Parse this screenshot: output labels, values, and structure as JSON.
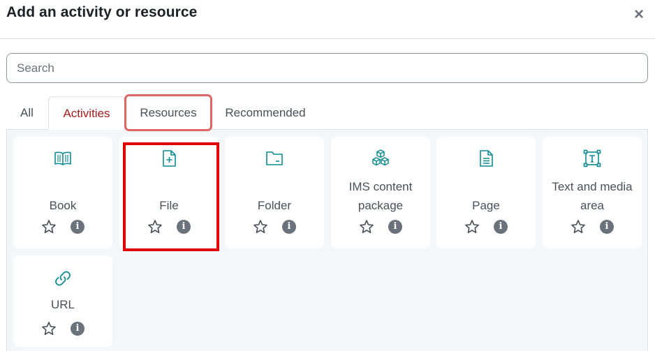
{
  "modal": {
    "title": "Add an activity or resource",
    "close_label": "×"
  },
  "search": {
    "placeholder": "Search",
    "value": ""
  },
  "tabs": [
    {
      "label": "All"
    },
    {
      "label": "Activities",
      "active": true
    },
    {
      "label": "Resources",
      "highlighted": true
    },
    {
      "label": "Recommended"
    }
  ],
  "items": [
    {
      "name": "Book",
      "icon": "book-icon"
    },
    {
      "name": "File",
      "icon": "file-icon",
      "highlighted": true
    },
    {
      "name": "Folder",
      "icon": "folder-icon"
    },
    {
      "name": "IMS content package",
      "line1": "IMS content",
      "line2": "package",
      "icon": "ims-package-icon"
    },
    {
      "name": "Page",
      "icon": "page-icon"
    },
    {
      "name": "Text and media area",
      "line1": "Text and media",
      "line2": "area",
      "icon": "text-media-icon"
    },
    {
      "name": "URL",
      "icon": "link-icon"
    }
  ],
  "card_actions": {
    "star_icon": "star-outline-icon",
    "info_label": "i"
  },
  "colors": {
    "accent_teal": "#0f8b96",
    "active_tab": "#a21d1d",
    "highlight_red": "#e00000",
    "highlight_soft_red": "#e06666"
  }
}
